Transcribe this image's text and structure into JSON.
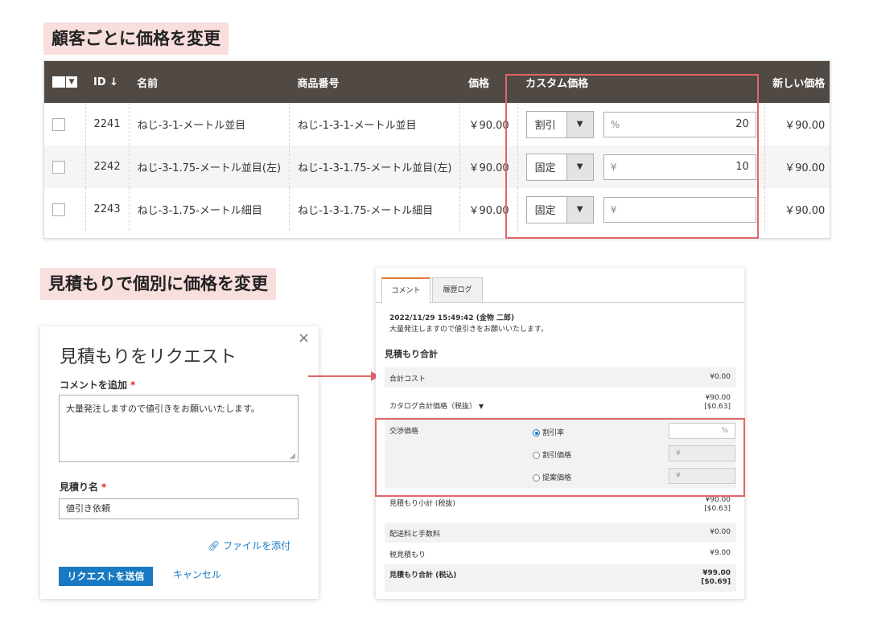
{
  "headings": {
    "customer_price": "顧客ごとに価格を変更",
    "quote_price": "見積もりで個別に価格を変更"
  },
  "grid": {
    "columns": {
      "id": "ID ↓",
      "name": "名前",
      "sku": "商品番号",
      "price": "価格",
      "custom_price": "カスタム価格",
      "new_price": "新しい価格"
    },
    "rows": [
      {
        "id": "2241",
        "name": "ねじ-3-1-メートル並目",
        "sku": "ねじ-1-3-1-メートル並目",
        "price": "￥90.00",
        "type": "割引",
        "unit": "%",
        "value": "20",
        "new_price": "￥90.00"
      },
      {
        "id": "2242",
        "name": "ねじ-3-1.75-メートル並目(左)",
        "sku": "ねじ-1-3-1.75-メートル並目(左)",
        "price": "￥90.00",
        "type": "固定",
        "unit": "¥",
        "value": "10",
        "new_price": "￥90.00"
      },
      {
        "id": "2243",
        "name": "ねじ-3-1.75-メートル細目",
        "sku": "ねじ-1-3-1.75-メートル細目",
        "price": "￥90.00",
        "type": "固定",
        "unit": "¥",
        "value": "",
        "new_price": "￥90.00"
      }
    ]
  },
  "modal": {
    "title": "見積もりをリクエスト",
    "close": "×",
    "comment_label": "コメントを追加",
    "required_mark": "*",
    "comment_value": "大量発注しますので値引きをお願いいたします。",
    "quote_name_label": "見積り名",
    "quote_name_value": "値引き依頼",
    "attach_label": "ファイルを添付",
    "submit_label": "リクエストを送信",
    "cancel_label": "キャンセル"
  },
  "quote": {
    "tabs": [
      "コメント",
      "履歴ログ"
    ],
    "comment_meta": "2022/11/29 15:49:42 (金物 二郎)",
    "comment_text": "大量発注しますので値引きをお願いいたします。",
    "section_title": "見積もり合計",
    "total_cost_label": "合計コスト",
    "total_cost_value": "¥0.00",
    "catalog_label": "カタログ合計価格（税抜）",
    "catalog_value": "¥90.00",
    "catalog_value2": "[$0.63]",
    "negotiated_label": "交渉価格",
    "options": [
      "割引率",
      "割引価格",
      "提案価格"
    ],
    "percent_unit": "%",
    "yen_unit": "¥",
    "subtotal_label": "見積もり小計 (税抜)",
    "subtotal_value": "¥90.00",
    "subtotal_value2": "[$0.63]",
    "shipping_label": "配送料と手数料",
    "shipping_value": "¥0.00",
    "tax_label": "税見積もり",
    "tax_value": "¥9.00",
    "grand_label": "見積もり合計 (税込)",
    "grand_value": "¥99.00",
    "grand_value2": "[$0.69]"
  },
  "colors": {
    "header_bg": "#514943",
    "highlight": "#e06666",
    "link": "#1979c3",
    "heading_bg": "#f9dede"
  }
}
